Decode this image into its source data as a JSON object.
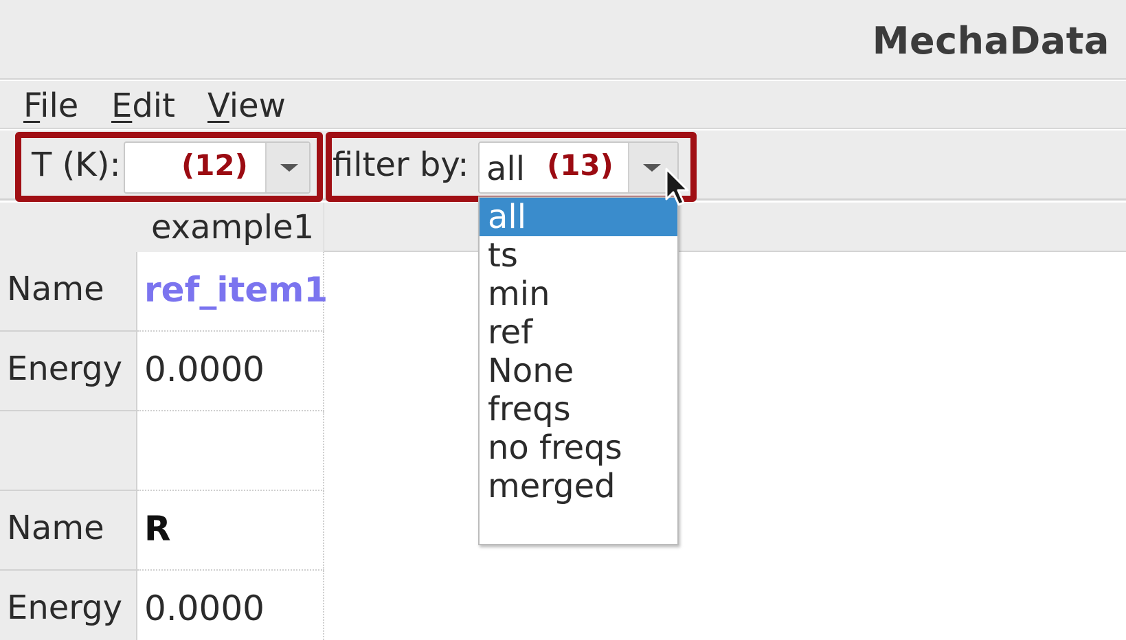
{
  "window": {
    "title": "MechaData"
  },
  "menu": {
    "items": [
      {
        "mnemonic": "F",
        "rest": "ile"
      },
      {
        "mnemonic": "E",
        "rest": "dit"
      },
      {
        "mnemonic": "V",
        "rest": "iew"
      }
    ]
  },
  "toolbar": {
    "temperature_label": "T (K):",
    "temperature_value": "",
    "filter_label": "filter by:",
    "filter_value": "all"
  },
  "callouts": {
    "temperature": "(12)",
    "filter": "(13)"
  },
  "filter_options": [
    "all",
    "ts",
    "min",
    "ref",
    "None",
    "freqs",
    "no freqs",
    "merged"
  ],
  "filter_selected": "all",
  "table": {
    "column_header": "example1",
    "rows": [
      {
        "header": "Name",
        "value": "ref_item1"
      },
      {
        "header": "Energy",
        "value": "0.0000"
      },
      {
        "header": "",
        "value": ""
      },
      {
        "header": "Name",
        "value": "R"
      },
      {
        "header": "Energy",
        "value": "0.0000"
      }
    ]
  },
  "colors": {
    "highlight": "#a00f14",
    "selection": "#3a8ccc",
    "link": "#7b74ef"
  }
}
